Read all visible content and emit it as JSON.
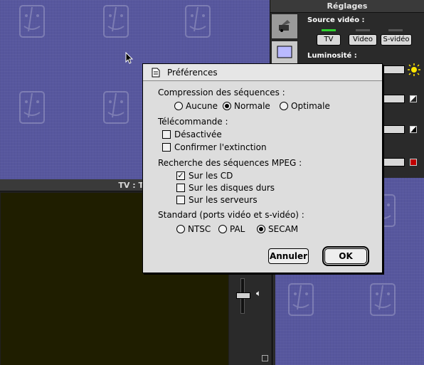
{
  "reglages": {
    "title": "Réglages",
    "source_video_label": "Source vidéo :",
    "source_buttons": [
      "TV",
      "Video",
      "S-vidéo"
    ],
    "luminosite_label": "Luminosité :"
  },
  "tv_window": {
    "title": "TV : T"
  },
  "dialog": {
    "title": "Préférences",
    "compression": {
      "label": "Compression des séquences :",
      "options": [
        "Aucune",
        "Normale",
        "Optimale"
      ],
      "selected": "Normale"
    },
    "telecommande": {
      "label": "Télécommande :",
      "options": [
        {
          "label": "Désactivée",
          "checked": false
        },
        {
          "label": "Confirmer l'extinction",
          "checked": false
        }
      ]
    },
    "mpeg": {
      "label": "Recherche des séquences MPEG :",
      "options": [
        {
          "label": "Sur les CD",
          "checked": true
        },
        {
          "label": "Sur les disques durs",
          "checked": false
        },
        {
          "label": "Sur les serveurs",
          "checked": false
        }
      ]
    },
    "standard": {
      "label": "Standard (ports vidéo et s-vidéo) :",
      "options": [
        "NTSC",
        "PAL",
        "SECAM"
      ],
      "selected": "SECAM"
    },
    "cancel_label": "Annuler",
    "ok_label": "OK"
  },
  "colors": {
    "desktop": "#57579e",
    "dialog_bg": "#dddddd",
    "led_on": "#2fd12f"
  }
}
